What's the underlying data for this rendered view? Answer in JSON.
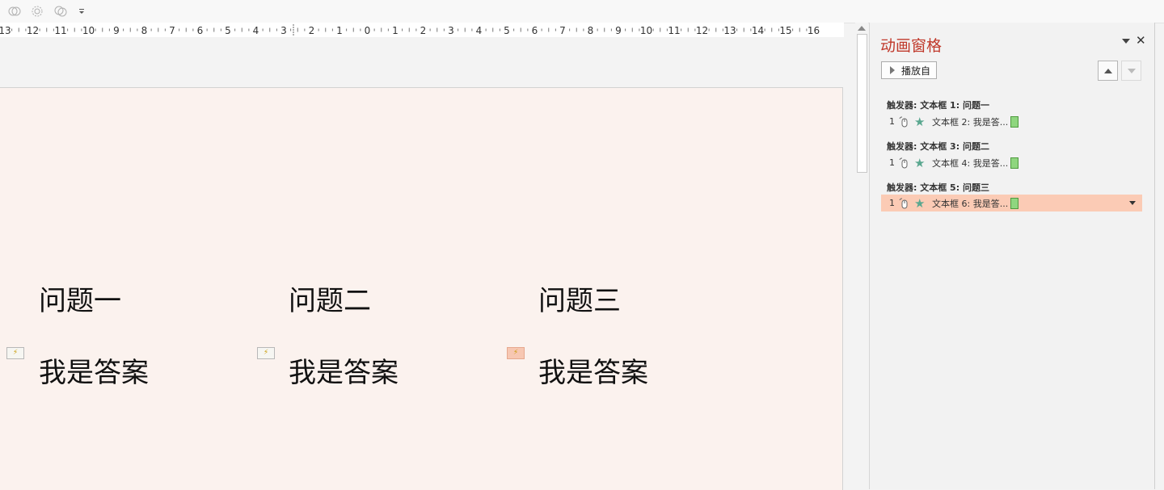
{
  "ruler": {
    "labels": [
      "13",
      "12",
      "11",
      "10",
      "9",
      "8",
      "7",
      "6",
      "5",
      "4",
      "3",
      "2",
      "1",
      "0",
      "1",
      "2",
      "3",
      "4",
      "5",
      "6",
      "7",
      "8",
      "9",
      "10",
      "11",
      "12",
      "13",
      "14",
      "15",
      "16"
    ]
  },
  "slide": {
    "questions": [
      {
        "label": "问题一",
        "answer": "我是答案"
      },
      {
        "label": "问题二",
        "answer": "我是答案"
      },
      {
        "label": "问题三",
        "answer": "我是答案"
      }
    ]
  },
  "pane": {
    "title": "动画窗格",
    "close_glyph": "✕",
    "play_label": "播放自",
    "groups": [
      {
        "trigger": "触发器: 文本框 1: 问题一",
        "num": "1",
        "effect": "文本框 2: 我是答...",
        "selected": false
      },
      {
        "trigger": "触发器: 文本框 3: 问题二",
        "num": "1",
        "effect": "文本框 4: 我是答...",
        "selected": false
      },
      {
        "trigger": "触发器: 文本框 5: 问题三",
        "num": "1",
        "effect": "文本框 6: 我是答...",
        "selected": true
      }
    ]
  },
  "colors": {
    "pane_title": "#c0392b",
    "selected_row": "#fbcbb5",
    "slide_bg": "#fbf2ee",
    "effect_star": "#5aa78f",
    "timing_bar": "#8fd67f"
  },
  "icons": {
    "qat": [
      "shape-union-icon",
      "shape-fragment-icon",
      "shape-intersect-icon",
      "customize-dropdown-icon"
    ],
    "trigger_marker": "lightning-icon",
    "effect": "star-icon",
    "trigger_type": "mouse-click-icon"
  }
}
